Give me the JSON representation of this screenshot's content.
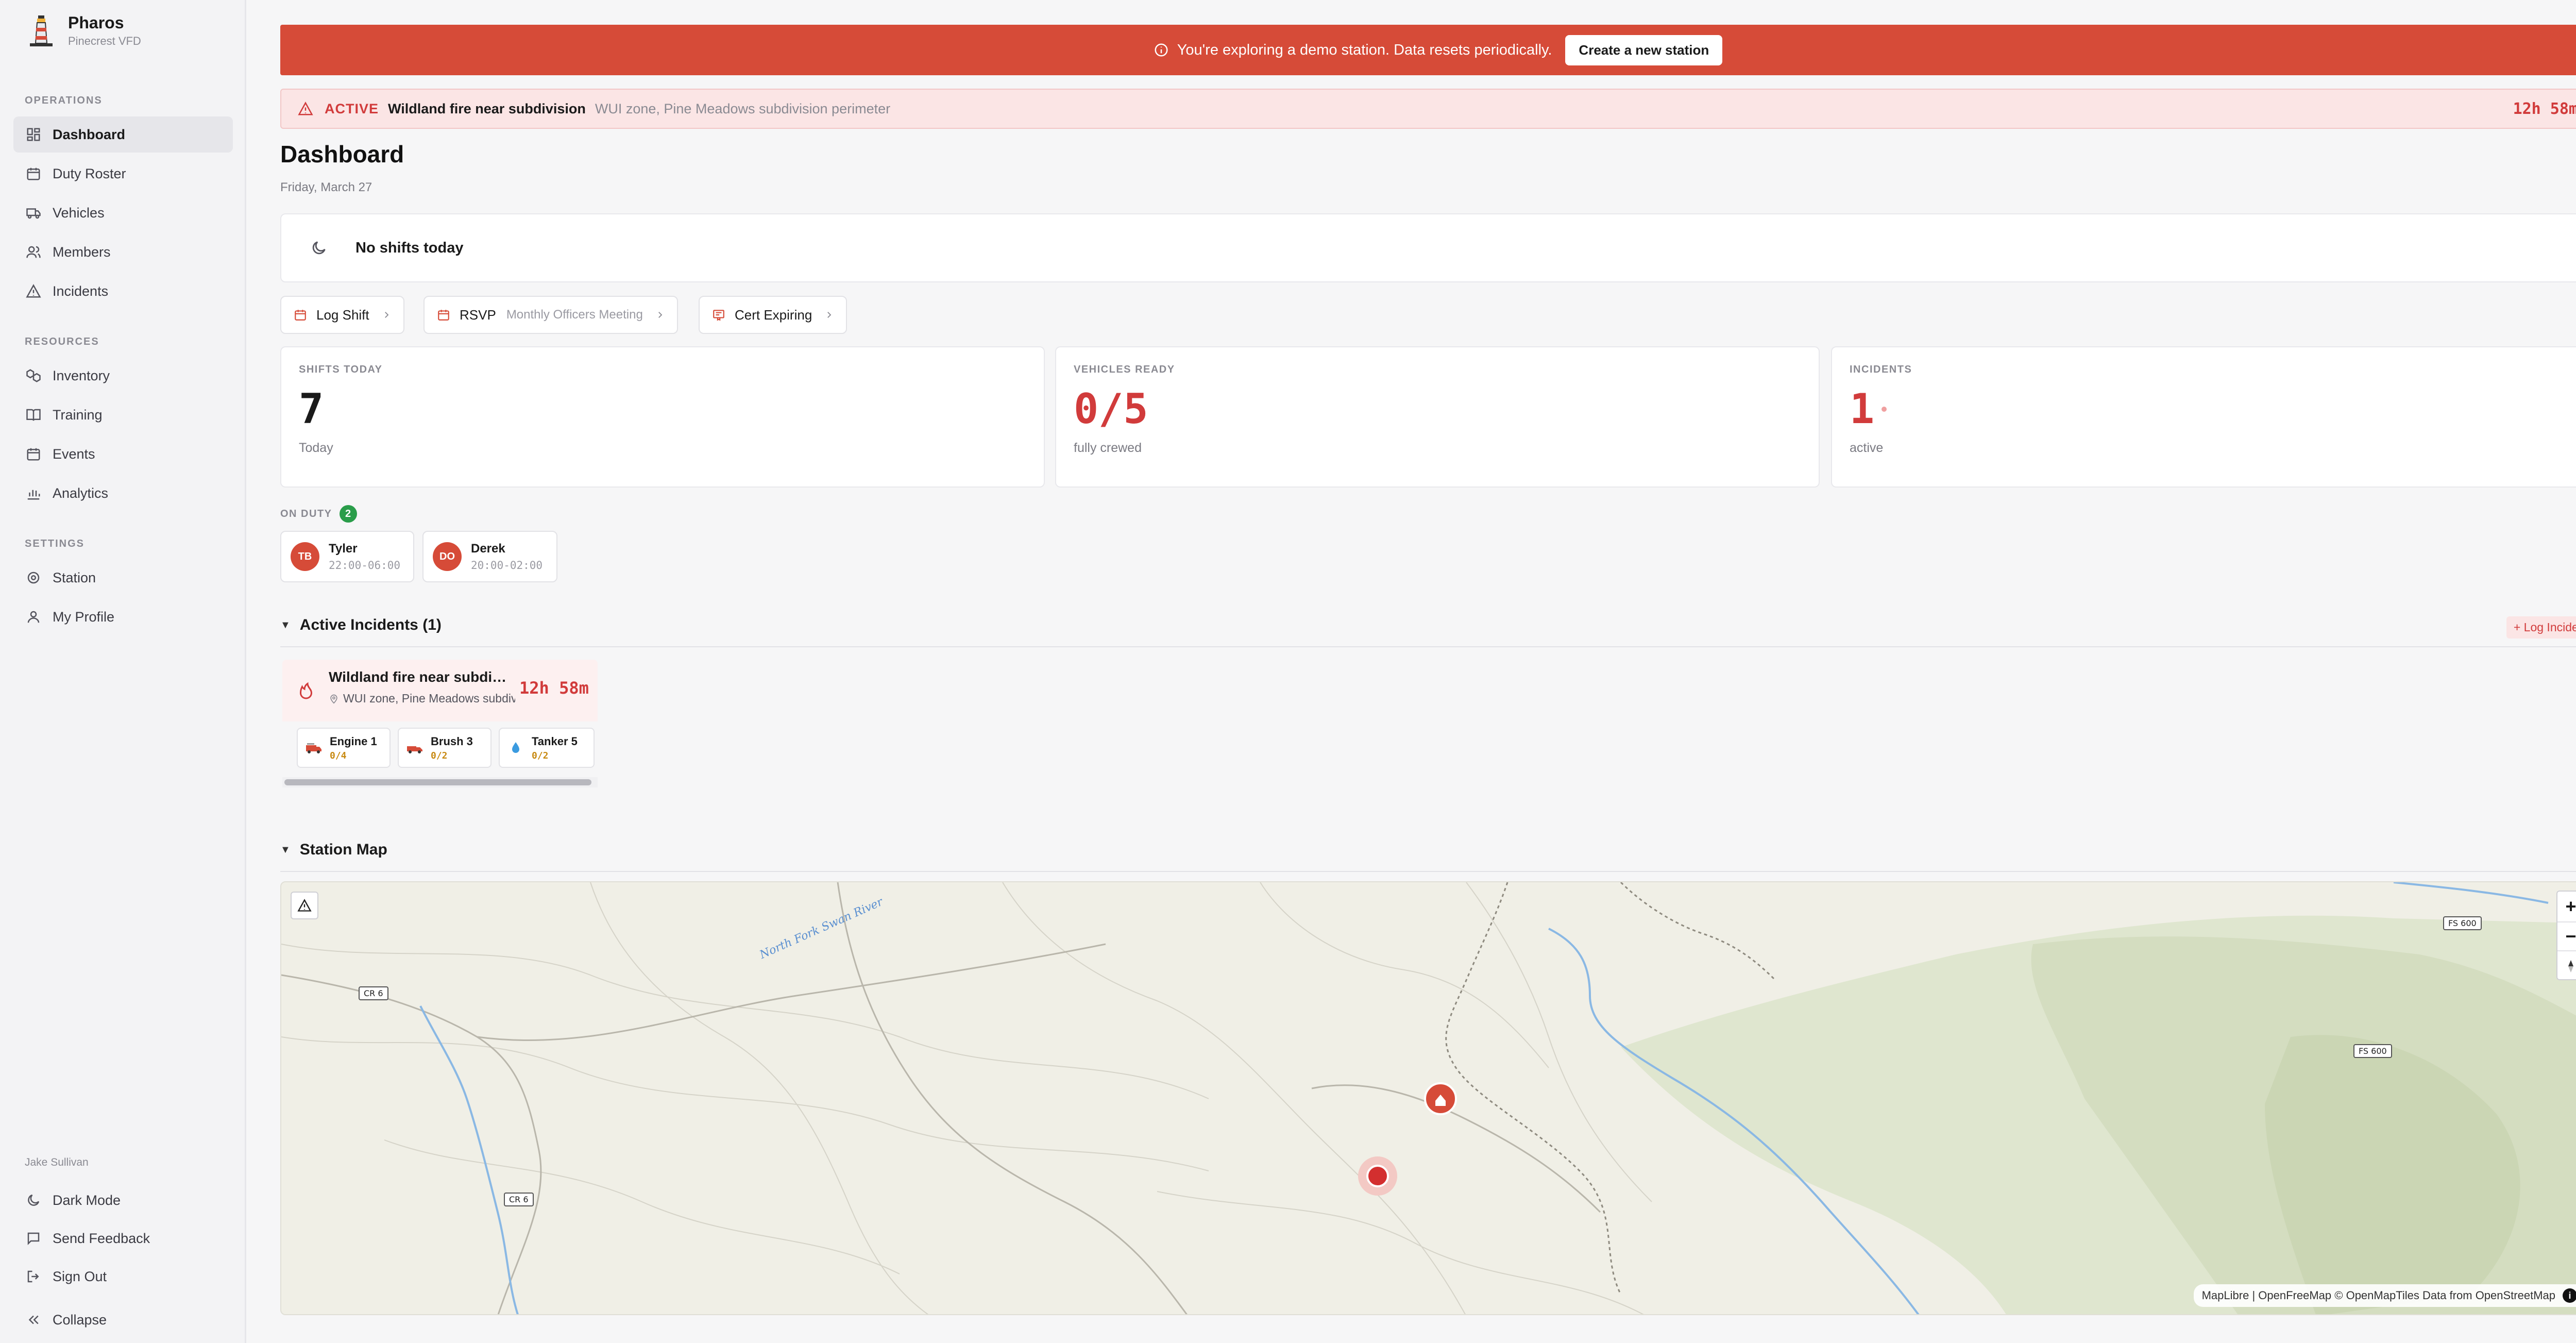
{
  "brand": {
    "name": "Pharos",
    "station": "Pinecrest VFD"
  },
  "nav": {
    "operations_label": "OPERATIONS",
    "operations": [
      {
        "label": "Dashboard",
        "icon": "dashboard-icon"
      },
      {
        "label": "Duty Roster",
        "icon": "calendar-icon"
      },
      {
        "label": "Vehicles",
        "icon": "truck-icon"
      },
      {
        "label": "Members",
        "icon": "users-icon"
      },
      {
        "label": "Incidents",
        "icon": "warning-icon"
      }
    ],
    "resources_label": "RESOURCES",
    "resources": [
      {
        "label": "Inventory",
        "icon": "boxes-icon"
      },
      {
        "label": "Training",
        "icon": "book-icon"
      },
      {
        "label": "Events",
        "icon": "calendar-icon"
      },
      {
        "label": "Analytics",
        "icon": "bar-chart-icon"
      }
    ],
    "settings_label": "SETTINGS",
    "settings": [
      {
        "label": "Station",
        "icon": "gear-icon"
      },
      {
        "label": "My Profile",
        "icon": "user-icon"
      }
    ],
    "user_name": "Jake Sullivan",
    "bottom": [
      {
        "label": "Dark Mode",
        "icon": "moon-icon"
      },
      {
        "label": "Send Feedback",
        "icon": "chat-icon"
      },
      {
        "label": "Sign Out",
        "icon": "sign-out-icon"
      },
      {
        "label": "Collapse",
        "icon": "double-chevron-left-icon"
      }
    ]
  },
  "demo_banner": {
    "text": "You're exploring a demo station. Data resets periodically.",
    "button": "Create a new station",
    "color": "#d64b38"
  },
  "alert": {
    "status": "ACTIVE",
    "title": "Wildland fire near subdivision",
    "location": "WUI zone, Pine Meadows subdivision perimeter",
    "timer": "12h 58m"
  },
  "page": {
    "title": "Dashboard",
    "date": "Friday, March 27"
  },
  "shifts_card": {
    "text": "No shifts today"
  },
  "quick_actions": [
    {
      "label": "Log Shift",
      "sub": ""
    },
    {
      "label": "RSVP",
      "sub": "Monthly Officers Meeting"
    },
    {
      "label": "Cert Expiring",
      "sub": ""
    }
  ],
  "stats": [
    {
      "label": "SHIFTS TODAY",
      "value": "7",
      "note": "Today"
    },
    {
      "label": "VEHICLES READY",
      "value": "0/5",
      "note": "fully crewed"
    },
    {
      "label": "INCIDENTS",
      "value": "1",
      "note": "active"
    }
  ],
  "on_duty": {
    "label": "ON DUTY",
    "count": "2",
    "members": [
      {
        "initials": "TB",
        "name": "Tyler",
        "time": "22:00-06:00"
      },
      {
        "initials": "DO",
        "name": "Derek",
        "time": "20:00-02:00"
      }
    ]
  },
  "active_incidents": {
    "heading": "Active Incidents (1)",
    "log_button": "+ Log Incident",
    "card": {
      "title": "Wildland fire near subdivision",
      "location": "WUI zone, Pine Meadows subdivision perimeter",
      "timer": "12h 58m",
      "vehicles": [
        {
          "name": "Engine 1",
          "crew": "0/4",
          "icon": "fire-truck-icon"
        },
        {
          "name": "Brush 3",
          "crew": "0/2",
          "icon": "fire-truck-icon"
        },
        {
          "name": "Tanker 5",
          "crew": "0/2",
          "icon": "water-drop-icon"
        }
      ]
    }
  },
  "station_map": {
    "heading": "Station Map",
    "road_labels": [
      "CR 6",
      "CR 6",
      "FS 600",
      "FS 600"
    ],
    "river_label": "North Fork Swan River",
    "attribution": {
      "maplibre": "MapLibre",
      "openfreemap": "OpenFreeMap",
      "openmaptiles": "© OpenMapTiles",
      "data_from": "Data from",
      "osm": "OpenStreetMap"
    }
  }
}
